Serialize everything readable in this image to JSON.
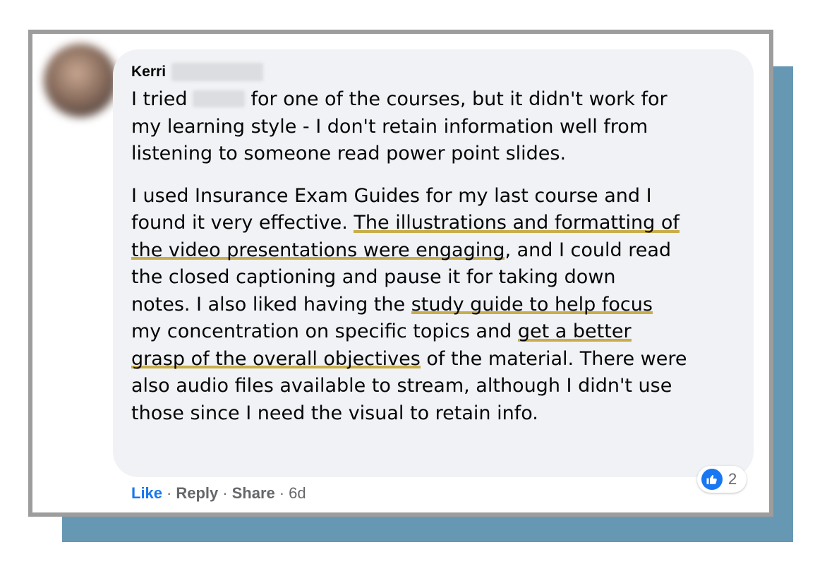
{
  "comment": {
    "author_first_name": "Kerri",
    "paragraph1": {
      "l1_before": "I tried",
      "l1_after": "for one of the courses, but it didn't work for",
      "l2": "my learning style - I don't retain information well from",
      "l3": "listening to someone read power point slides."
    },
    "paragraph2": {
      "l1": "I used Insurance Exam Guides for my last course and I",
      "l2_plain": "found it very effective. ",
      "l2_hl": "The illustrations and formatting of",
      "l3_hl": "the video presentations were engaging",
      "l3_plain": ", and I could read",
      "l4": "the closed captioning and pause it for taking down",
      "l5_plain": "notes. I also liked having the ",
      "l5_hl": "study guide to help focus",
      "l6_plain": "my concentration on specific topics and ",
      "l6_hl": "get a better",
      "l7_hl": "grasp of the overall objectives",
      "l7_plain": " of the material. There were",
      "l8": "also audio files available to stream, although I didn't use",
      "l9": "those since I need the visual to retain info."
    }
  },
  "actions": {
    "like": "Like",
    "reply": "Reply",
    "share": "Share",
    "separator": "·",
    "time": "6d"
  },
  "reaction": {
    "icon": "thumbs-up-icon",
    "count": "2"
  },
  "colors": {
    "accent": "#1877f2",
    "bubble": "#f0f2f5",
    "highlight_underline": "#c9ad4a",
    "shadow_block": "#6698b4",
    "frame_border": "#9d9d9d"
  }
}
